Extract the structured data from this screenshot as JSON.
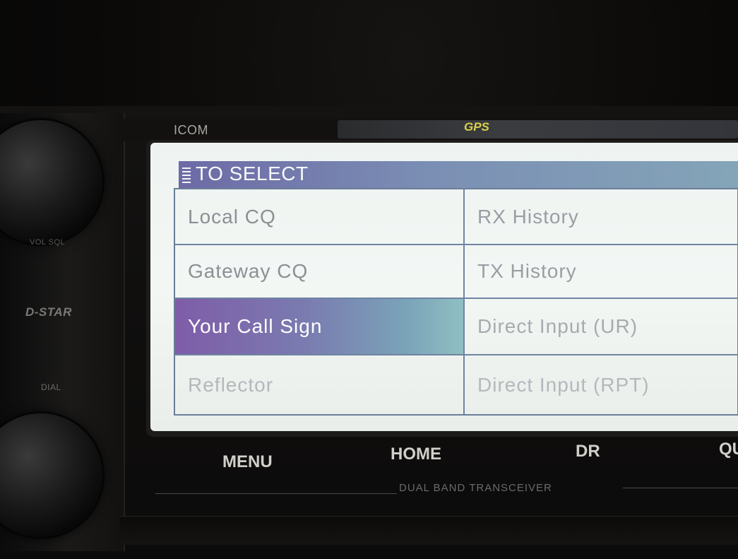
{
  "device": {
    "brand": "ICOM",
    "gps_badge": "GPS",
    "left_labels": {
      "vol_sql": "VOL SQL",
      "dstar": "D-STAR",
      "dial": "DIAL"
    },
    "model_caption": "DUAL BAND TRANSCEIVER"
  },
  "screen": {
    "title": "TO SELECT",
    "menu": [
      {
        "label": "Local CQ",
        "selected": false
      },
      {
        "label": "RX History",
        "selected": false
      },
      {
        "label": "Gateway CQ",
        "selected": false
      },
      {
        "label": "TX History",
        "selected": false
      },
      {
        "label": "Your Call Sign",
        "selected": true
      },
      {
        "label": "Direct Input (UR)",
        "selected": false
      },
      {
        "label": "Reflector",
        "selected": false
      },
      {
        "label": "Direct Input (RPT)",
        "selected": false
      }
    ],
    "colors": {
      "highlight_start": "#7f5ca8",
      "highlight_end": "#8fbfc3",
      "title_bar": "#6d6aa6",
      "lcd_background": "#eef3f1"
    }
  },
  "hard_buttons": {
    "menu": "MENU",
    "home": "HOME",
    "dr": "DR",
    "quick": "QU"
  }
}
